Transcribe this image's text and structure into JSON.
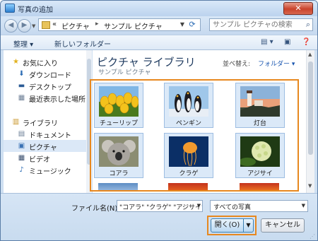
{
  "window": {
    "title": "写真の追加",
    "close_label": "✕"
  },
  "address": {
    "chevron": "«",
    "segments": [
      "ピクチャ",
      "サンプル ピクチャ"
    ],
    "separator": "▸",
    "search_placeholder": "サンプル ピクチャの検索"
  },
  "toolbar": {
    "organize_label": "整理 ▾",
    "new_folder_label": "新しいフォルダー"
  },
  "navigation": {
    "favorites_header": "お気に入り",
    "favorites": [
      "ダウンロード",
      "デスクトップ",
      "最近表示した場所"
    ],
    "libraries_header": "ライブラリ",
    "libraries": [
      "ドキュメント",
      "ピクチャ",
      "ビデオ",
      "ミュージック"
    ],
    "selected": "ピクチャ"
  },
  "library": {
    "title": "ピクチャ ライブラリ",
    "subtitle": "サンプル ピクチャ",
    "arrange_label": "並べ替え:",
    "arrange_value": "フォルダー ▾"
  },
  "files": [
    {
      "name": "チューリップ",
      "icon": "tulip-thumbnail"
    },
    {
      "name": "ペンギン",
      "icon": "penguins-thumbnail"
    },
    {
      "name": "灯台",
      "icon": "lighthouse-thumbnail"
    },
    {
      "name": "コアラ",
      "icon": "koala-thumbnail"
    },
    {
      "name": "クラゲ",
      "icon": "jellyfish-thumbnail"
    },
    {
      "name": "アジサイ",
      "icon": "hydrangea-thumbnail"
    }
  ],
  "footer": {
    "filename_label": "ファイル名(N):",
    "filename_value": "\"コアラ\" \"クラゲ\" \"アジサイ\"",
    "filetype_value": "すべての写真",
    "open_label": "開く(O)",
    "cancel_label": "キャンセル"
  },
  "colors": {
    "highlight": "#e7881f",
    "selection": "#dbe9f8",
    "title_blue": "#1e3a5f"
  }
}
